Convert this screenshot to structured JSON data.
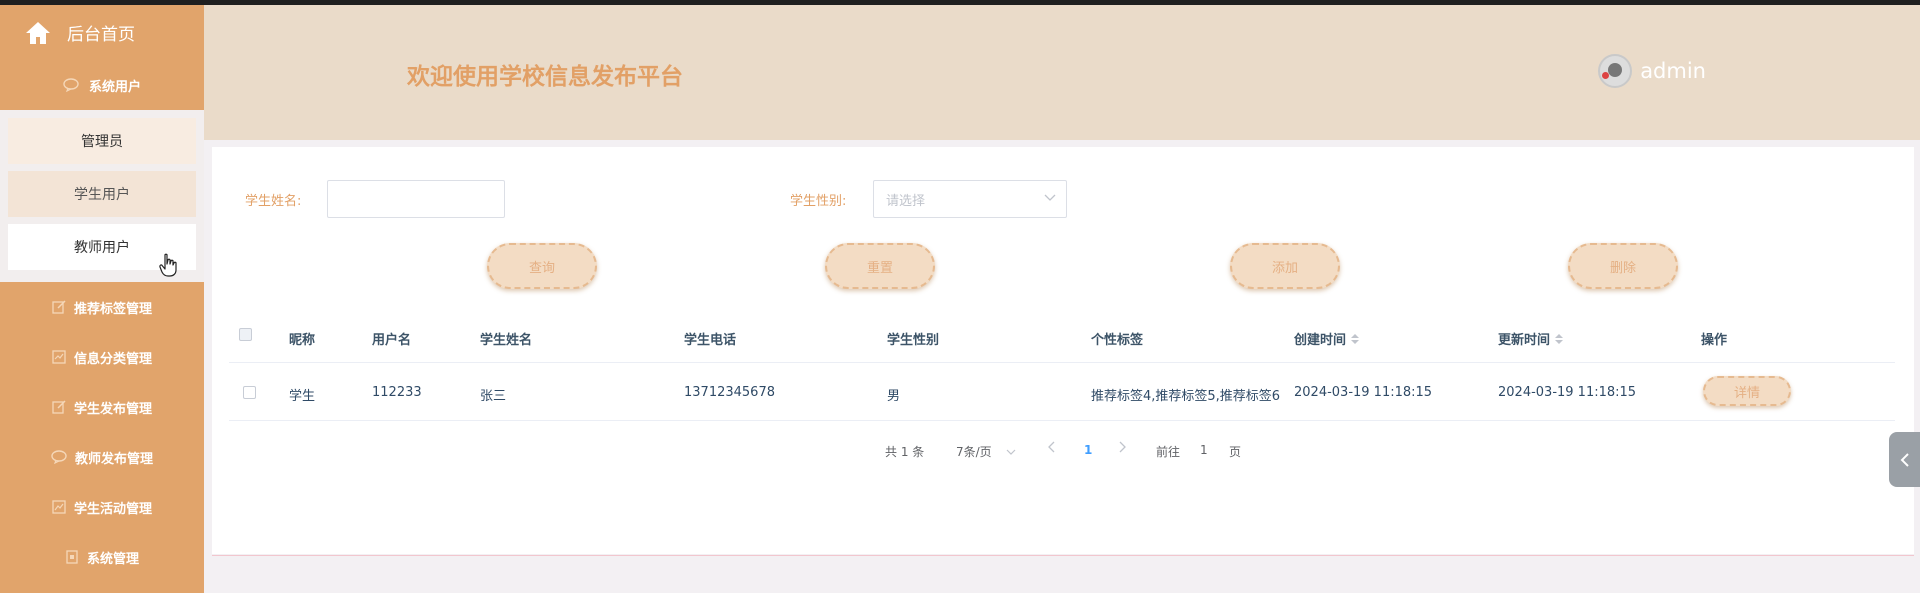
{
  "sidebar": {
    "home": "后台首页",
    "group": "系统用户",
    "sub_items": [
      "管理员",
      "学生用户",
      "教师用户"
    ],
    "nav": [
      {
        "label": "推荐标签管理",
        "icon": "edit-icon"
      },
      {
        "label": "信息分类管理",
        "icon": "doc-icon"
      },
      {
        "label": "学生发布管理",
        "icon": "edit-icon"
      },
      {
        "label": "教师发布管理",
        "icon": "message-icon"
      },
      {
        "label": "学生活动管理",
        "icon": "chart-icon"
      },
      {
        "label": "系统管理",
        "icon": "box-icon"
      }
    ]
  },
  "header": {
    "title": "欢迎使用学校信息发布平台",
    "username": "admin"
  },
  "search": {
    "name_label": "学生姓名:",
    "name_value": "",
    "gender_label": "学生性别:",
    "gender_placeholder": "请选择"
  },
  "buttons": {
    "query": "查询",
    "reset": "重置",
    "add": "添加",
    "delete": "删除"
  },
  "table": {
    "headers": [
      "昵称",
      "用户名",
      "学生姓名",
      "学生电话",
      "学生性别",
      "个性标签",
      "创建时间",
      "更新时间",
      "操作"
    ],
    "rows": [
      {
        "nickname": "学生",
        "username": "112233",
        "name": "张三",
        "phone": "13712345678",
        "gender": "男",
        "tags": "推荐标签4,推荐标签5,推荐标签6",
        "created": "2024-03-19 11:18:15",
        "updated": "2024-03-19 11:18:15",
        "action": "详情"
      }
    ]
  },
  "pagination": {
    "total": "共 1 条",
    "page_size": "7条/页",
    "current_page": "1",
    "goto_label": "前往",
    "goto_value": "1",
    "page_suffix": "页"
  },
  "colors": {
    "sidebar": "#e1a46b",
    "header": "#eadbc9",
    "accent": "#e2a066",
    "button_bg": "#f3dcc4"
  }
}
